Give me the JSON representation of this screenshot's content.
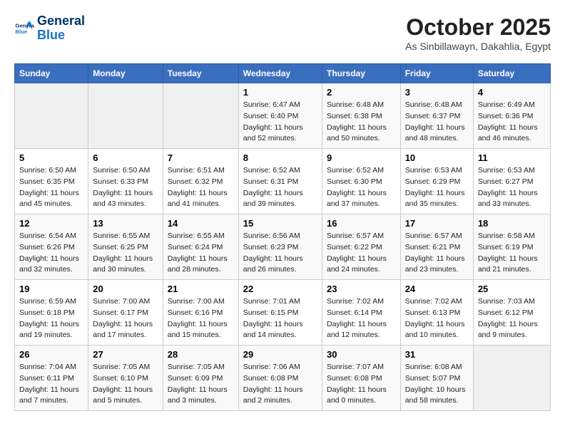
{
  "header": {
    "logo_line1": "General",
    "logo_line2": "Blue",
    "month": "October 2025",
    "location": "As Sinbillawayn, Dakahlia, Egypt"
  },
  "weekdays": [
    "Sunday",
    "Monday",
    "Tuesday",
    "Wednesday",
    "Thursday",
    "Friday",
    "Saturday"
  ],
  "weeks": [
    [
      {
        "day": "",
        "empty": true
      },
      {
        "day": "",
        "empty": true
      },
      {
        "day": "",
        "empty": true
      },
      {
        "day": "1",
        "sunrise": "6:47 AM",
        "sunset": "6:40 PM",
        "daylight": "11 hours and 52 minutes."
      },
      {
        "day": "2",
        "sunrise": "6:48 AM",
        "sunset": "6:38 PM",
        "daylight": "11 hours and 50 minutes."
      },
      {
        "day": "3",
        "sunrise": "6:48 AM",
        "sunset": "6:37 PM",
        "daylight": "11 hours and 48 minutes."
      },
      {
        "day": "4",
        "sunrise": "6:49 AM",
        "sunset": "6:36 PM",
        "daylight": "11 hours and 46 minutes."
      }
    ],
    [
      {
        "day": "5",
        "sunrise": "6:50 AM",
        "sunset": "6:35 PM",
        "daylight": "11 hours and 45 minutes."
      },
      {
        "day": "6",
        "sunrise": "6:50 AM",
        "sunset": "6:33 PM",
        "daylight": "11 hours and 43 minutes."
      },
      {
        "day": "7",
        "sunrise": "6:51 AM",
        "sunset": "6:32 PM",
        "daylight": "11 hours and 41 minutes."
      },
      {
        "day": "8",
        "sunrise": "6:52 AM",
        "sunset": "6:31 PM",
        "daylight": "11 hours and 39 minutes."
      },
      {
        "day": "9",
        "sunrise": "6:52 AM",
        "sunset": "6:30 PM",
        "daylight": "11 hours and 37 minutes."
      },
      {
        "day": "10",
        "sunrise": "6:53 AM",
        "sunset": "6:29 PM",
        "daylight": "11 hours and 35 minutes."
      },
      {
        "day": "11",
        "sunrise": "6:53 AM",
        "sunset": "6:27 PM",
        "daylight": "11 hours and 33 minutes."
      }
    ],
    [
      {
        "day": "12",
        "sunrise": "6:54 AM",
        "sunset": "6:26 PM",
        "daylight": "11 hours and 32 minutes."
      },
      {
        "day": "13",
        "sunrise": "6:55 AM",
        "sunset": "6:25 PM",
        "daylight": "11 hours and 30 minutes."
      },
      {
        "day": "14",
        "sunrise": "6:55 AM",
        "sunset": "6:24 PM",
        "daylight": "11 hours and 28 minutes."
      },
      {
        "day": "15",
        "sunrise": "6:56 AM",
        "sunset": "6:23 PM",
        "daylight": "11 hours and 26 minutes."
      },
      {
        "day": "16",
        "sunrise": "6:57 AM",
        "sunset": "6:22 PM",
        "daylight": "11 hours and 24 minutes."
      },
      {
        "day": "17",
        "sunrise": "6:57 AM",
        "sunset": "6:21 PM",
        "daylight": "11 hours and 23 minutes."
      },
      {
        "day": "18",
        "sunrise": "6:58 AM",
        "sunset": "6:19 PM",
        "daylight": "11 hours and 21 minutes."
      }
    ],
    [
      {
        "day": "19",
        "sunrise": "6:59 AM",
        "sunset": "6:18 PM",
        "daylight": "11 hours and 19 minutes."
      },
      {
        "day": "20",
        "sunrise": "7:00 AM",
        "sunset": "6:17 PM",
        "daylight": "11 hours and 17 minutes."
      },
      {
        "day": "21",
        "sunrise": "7:00 AM",
        "sunset": "6:16 PM",
        "daylight": "11 hours and 15 minutes."
      },
      {
        "day": "22",
        "sunrise": "7:01 AM",
        "sunset": "6:15 PM",
        "daylight": "11 hours and 14 minutes."
      },
      {
        "day": "23",
        "sunrise": "7:02 AM",
        "sunset": "6:14 PM",
        "daylight": "11 hours and 12 minutes."
      },
      {
        "day": "24",
        "sunrise": "7:02 AM",
        "sunset": "6:13 PM",
        "daylight": "11 hours and 10 minutes."
      },
      {
        "day": "25",
        "sunrise": "7:03 AM",
        "sunset": "6:12 PM",
        "daylight": "11 hours and 9 minutes."
      }
    ],
    [
      {
        "day": "26",
        "sunrise": "7:04 AM",
        "sunset": "6:11 PM",
        "daylight": "11 hours and 7 minutes."
      },
      {
        "day": "27",
        "sunrise": "7:05 AM",
        "sunset": "6:10 PM",
        "daylight": "11 hours and 5 minutes."
      },
      {
        "day": "28",
        "sunrise": "7:05 AM",
        "sunset": "6:09 PM",
        "daylight": "11 hours and 3 minutes."
      },
      {
        "day": "29",
        "sunrise": "7:06 AM",
        "sunset": "6:08 PM",
        "daylight": "11 hours and 2 minutes."
      },
      {
        "day": "30",
        "sunrise": "7:07 AM",
        "sunset": "6:08 PM",
        "daylight": "11 hours and 0 minutes."
      },
      {
        "day": "31",
        "sunrise": "6:08 AM",
        "sunset": "5:07 PM",
        "daylight": "10 hours and 58 minutes."
      },
      {
        "day": "",
        "empty": true
      }
    ]
  ]
}
